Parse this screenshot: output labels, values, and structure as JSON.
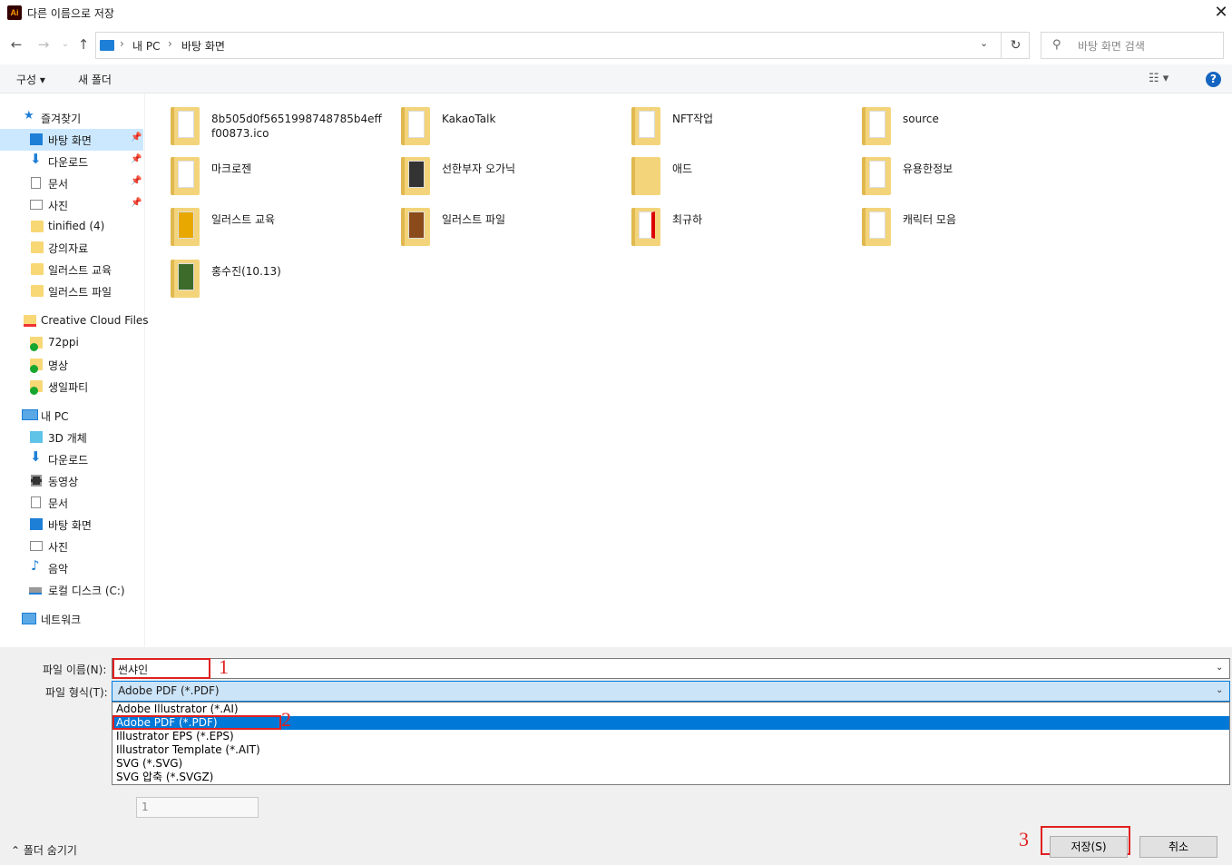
{
  "window": {
    "title": "다른 이름으로 저장",
    "app_icon": "Ai"
  },
  "nav": {
    "breadcrumb": [
      "내 PC",
      "바탕 화면"
    ],
    "search_placeholder": "바탕 화면 검색"
  },
  "toolbar": {
    "organize": "구성",
    "new_folder": "새 폴더",
    "help": "?"
  },
  "sidebar": {
    "items": [
      {
        "label": "즐겨찾기",
        "icon": "star-icon"
      },
      {
        "label": "바탕 화면",
        "icon": "desktop-icon",
        "pinned": true,
        "selected": true
      },
      {
        "label": "다운로드",
        "icon": "download-icon",
        "pinned": true
      },
      {
        "label": "문서",
        "icon": "document-icon",
        "pinned": true
      },
      {
        "label": "사진",
        "icon": "pictures-icon",
        "pinned": true
      },
      {
        "label": "tinified (4)",
        "icon": "folder-icon"
      },
      {
        "label": "강의자료",
        "icon": "folder-icon"
      },
      {
        "label": "일러스트 교육",
        "icon": "folder-icon"
      },
      {
        "label": "일러스트 파일",
        "icon": "folder-icon"
      },
      {
        "label": "Creative Cloud Files",
        "icon": "creative-cloud-folder-icon"
      },
      {
        "label": "72ppi",
        "icon": "synced-folder-icon"
      },
      {
        "label": "명상",
        "icon": "synced-folder-icon"
      },
      {
        "label": "생일파티",
        "icon": "synced-folder-icon"
      },
      {
        "label": "내 PC",
        "icon": "pc-icon"
      },
      {
        "label": "3D 개체",
        "icon": "3d-objects-icon"
      },
      {
        "label": "다운로드",
        "icon": "download-icon"
      },
      {
        "label": "동영상",
        "icon": "video-icon"
      },
      {
        "label": "문서",
        "icon": "document-icon"
      },
      {
        "label": "바탕 화면",
        "icon": "desktop-icon"
      },
      {
        "label": "사진",
        "icon": "pictures-icon"
      },
      {
        "label": "음악",
        "icon": "music-icon"
      },
      {
        "label": "로컬 디스크 (C:)",
        "icon": "disk-icon"
      },
      {
        "label": "네트워크",
        "icon": "network-icon"
      }
    ]
  },
  "files": [
    {
      "name": "8b505d0f5651998748785b4efff00873.ico"
    },
    {
      "name": "KakaoTalk"
    },
    {
      "name": "NFT작업"
    },
    {
      "name": "source"
    },
    {
      "name": "마크로젠"
    },
    {
      "name": "선한부자 오가닉"
    },
    {
      "name": "애드"
    },
    {
      "name": "유용한정보"
    },
    {
      "name": "일러스트 교육"
    },
    {
      "name": "일러스트 파일"
    },
    {
      "name": "최규하"
    },
    {
      "name": "캐릭터 모음"
    },
    {
      "name": "홍수진(10.13)"
    }
  ],
  "form": {
    "filename_label": "파일 이름(N):",
    "filename_value": "썬샤인",
    "filetype_label": "파일 형식(T):",
    "filetype_value": "Adobe PDF (*.PDF)",
    "filetype_options": [
      "Adobe Illustrator (*.AI)",
      "Adobe PDF (*.PDF)",
      "Illustrator EPS (*.EPS)",
      "Illustrator Template (*.AIT)",
      "SVG (*.SVG)",
      "SVG 압축 (*.SVGZ)"
    ],
    "range_value": "1"
  },
  "annotations": {
    "step1": "1",
    "step2": "2",
    "step3": "3"
  },
  "buttons": {
    "save": "저장(S)",
    "cancel": "취소",
    "hide_folders": "폴더 숨기기"
  },
  "colors": {
    "accent": "#0078d7",
    "annotation_red": "#e02020",
    "selection": "#cce8ff"
  }
}
